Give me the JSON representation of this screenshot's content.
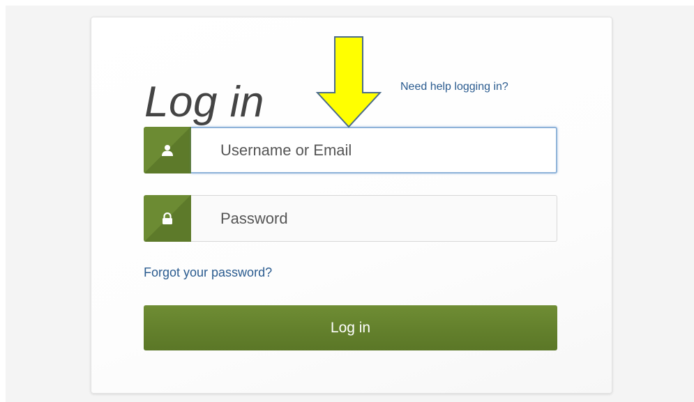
{
  "login": {
    "title": "Log in",
    "help_link": "Need help logging in?",
    "username_placeholder": "Username or Email",
    "password_placeholder": "Password",
    "forgot_link": "Forgot your password?",
    "submit_label": "Log in"
  },
  "icons": {
    "username": "user-icon",
    "password": "lock-icon",
    "annotation": "arrow-down-icon"
  },
  "colors": {
    "accent_green": "#63802c",
    "link_blue": "#2a5b8f",
    "annotation_yellow": "#ffff00",
    "focus_border": "#8fb3d9"
  }
}
